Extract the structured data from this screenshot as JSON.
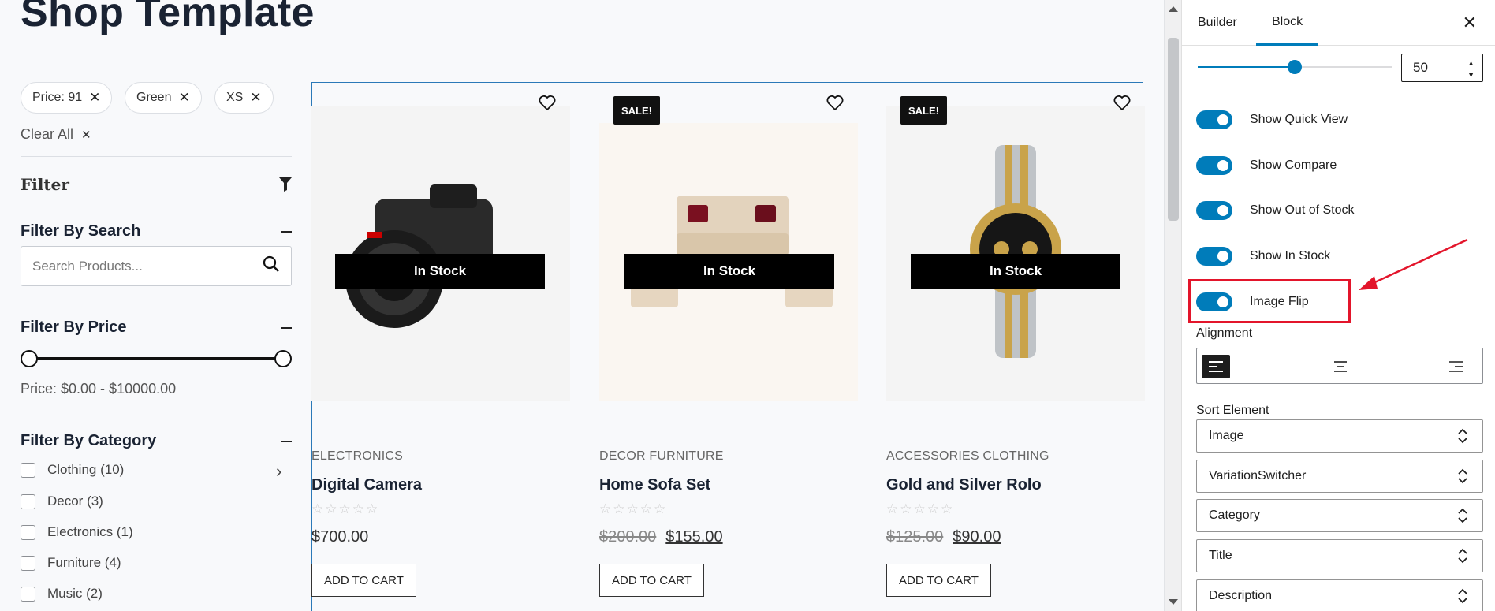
{
  "page": {
    "title": "Shop Template",
    "chips": [
      {
        "label": "Price: 91"
      },
      {
        "label": "Green"
      },
      {
        "label": "XS"
      }
    ],
    "clear_all": "Clear All",
    "filter_label": "Filter",
    "search": {
      "title": "Filter By Search",
      "placeholder": "Search Products..."
    },
    "price": {
      "title": "Filter By Price",
      "text": "Price: $0.00 - $10000.00"
    },
    "category": {
      "title": "Filter By Category",
      "items": [
        {
          "label": "Clothing (10)",
          "checked": false
        },
        {
          "label": "Decor (3)",
          "checked": false
        },
        {
          "label": "Electronics (1)",
          "checked": false
        },
        {
          "label": "Furniture (4)",
          "checked": false
        },
        {
          "label": "Music (2)",
          "checked": false
        }
      ]
    }
  },
  "products": [
    {
      "category": "ELECTRONICS",
      "title": "Digital Camera",
      "stock": "In Stock",
      "sale": "",
      "price_old": "",
      "price": "$700.00",
      "rating": 0,
      "cart": "ADD TO CART",
      "image": "camera"
    },
    {
      "category": "DECOR  FURNITURE",
      "title": "Home Sofa Set",
      "stock": "In Stock",
      "sale": "SALE!",
      "price_old": "$200.00",
      "price": "$155.00",
      "rating": 0,
      "cart": "ADD TO CART",
      "image": "sofa"
    },
    {
      "category": "ACCESSORIES  CLOTHING",
      "title": "Gold and Silver Rolo",
      "stock": "In Stock",
      "sale": "SALE!",
      "price_old": "$125.00",
      "price": "$90.00",
      "rating": 0,
      "cart": "ADD TO CART",
      "image": "watch"
    }
  ],
  "sidebar": {
    "tabs": [
      {
        "label": "Builder"
      },
      {
        "label": "Block"
      }
    ],
    "active_tab": "Block",
    "slider_value": "50",
    "toggles": [
      {
        "label": "Show Quick View",
        "on": true
      },
      {
        "label": "Show Compare",
        "on": true
      },
      {
        "label": "Show Out of Stock",
        "on": true
      },
      {
        "label": "Show In Stock",
        "on": true
      },
      {
        "label": "Image Flip",
        "on": true
      }
    ],
    "alignment_label": "Alignment",
    "sort_label": "Sort Element",
    "sort_items": [
      "Image",
      "VariationSwitcher",
      "Category",
      "Title",
      "Description"
    ]
  },
  "colors": {
    "accent": "#007cba",
    "annotation": "#e3152b",
    "grid_outline": "#2b79b8"
  },
  "icons": [
    "close-icon",
    "heart-icon",
    "search-icon",
    "filter-funnel-icon",
    "chevron-right-icon",
    "chevron-up-down-icon",
    "align-left-icon",
    "align-center-icon",
    "align-right-icon",
    "annotation-arrow-icon"
  ]
}
